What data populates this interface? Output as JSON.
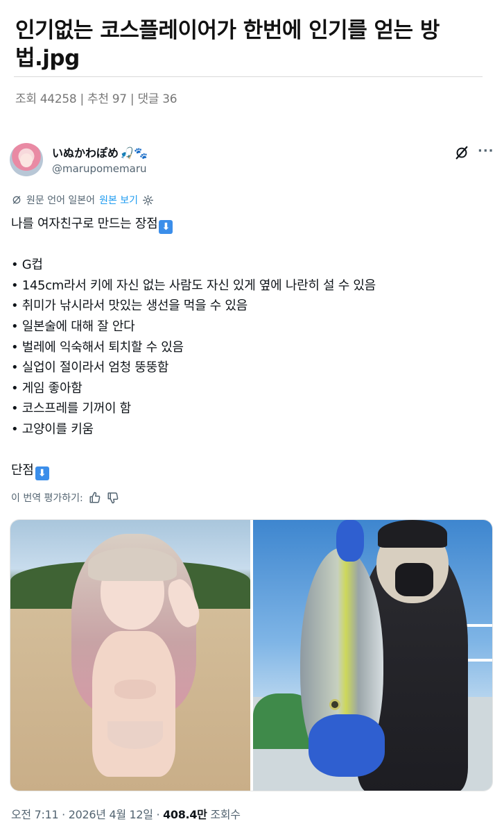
{
  "post": {
    "title": "인기없는 코스플레이어가 한번에 인기를 얻는 방법.jpg",
    "stats": "조회 44258 | 추천 97 | 댓글 36"
  },
  "tweet": {
    "display_name": "いぬかわぽめ",
    "name_emoji": "🎣🐾",
    "handle": "@marupomemaru",
    "translate": {
      "label": "원문 언어 일본어",
      "show_original": "원본 보기"
    },
    "body": {
      "intro": "나를 여자친구로 만드는 장점",
      "pros": [
        "• G컵",
        "• 145cm라서 키에 자신 없는 사람도 자신 있게 옆에 나란히 설 수 있음",
        "• 취미가 낚시라서 맛있는 생선을 먹을 수 있음",
        "• 일본술에 대해 잘 안다",
        "• 벌레에 익숙해서 퇴치할 수 있음",
        "• 실업이 절이라서 엄청 뚱뚱함",
        "• 게임 좋아함",
        "• 코스프레를 기꺼이 함",
        "• 고양이를 키움"
      ],
      "cons_label": "단점",
      "arrow": "⬇"
    },
    "rate_translation": "이 번역 평가하기:",
    "meta": {
      "time": "오전 7:11 · 2026년 4월 12일 · ",
      "views": "408.4만",
      "views_label": " 조회수"
    }
  },
  "colors": {
    "link": "#1d9bf0",
    "muted": "#536471",
    "text": "#0f1419"
  },
  "icons": [
    "grok-icon",
    "more-icon",
    "translate-icon",
    "settings-icon",
    "thumbs-up-icon",
    "thumbs-down-icon",
    "arrow-down-emoji-icon"
  ]
}
